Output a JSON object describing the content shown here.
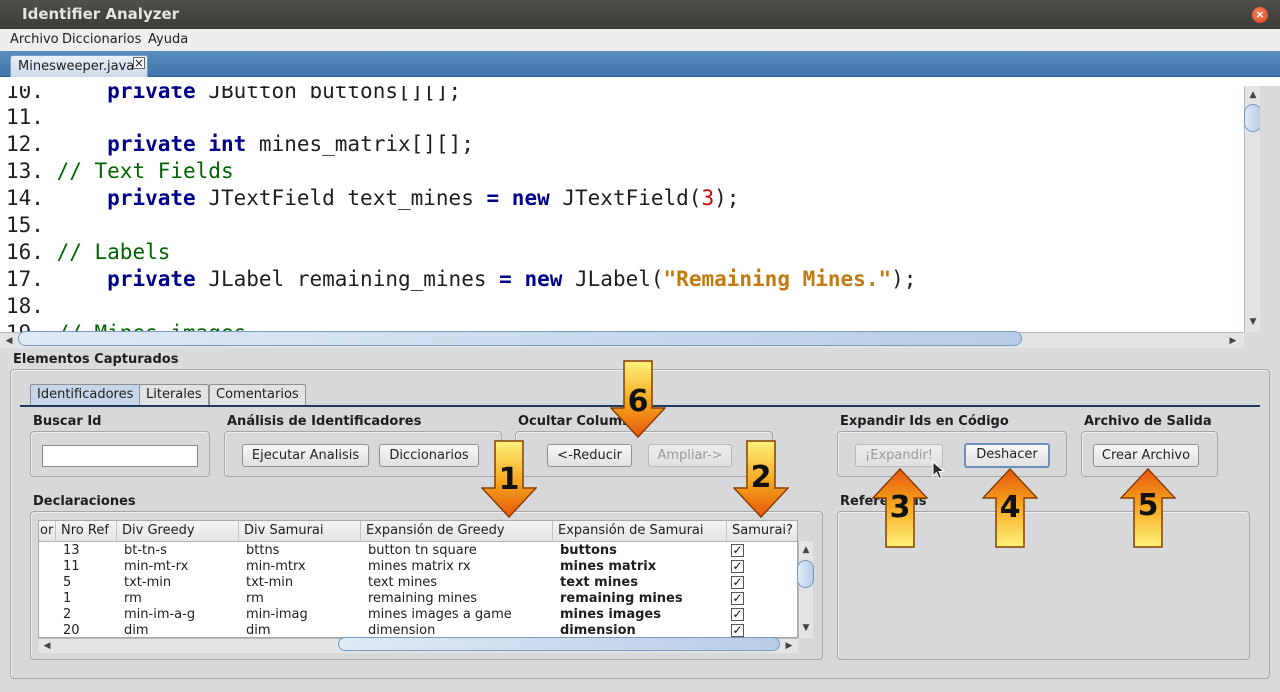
{
  "window": {
    "title": "Identifier Analyzer",
    "close_glyph": "×"
  },
  "menu": [
    "Archivo",
    "Diccionarios",
    "Ayuda"
  ],
  "editor_tab": {
    "label": "Minesweeper.java",
    "close_glyph": "×"
  },
  "code_lines": [
    {
      "num": "10.",
      "parts": [
        [
          "",
          "    "
        ],
        [
          "kw",
          "private"
        ],
        [
          "",
          " JButton buttons[][];"
        ]
      ]
    },
    {
      "num": "11.",
      "parts": []
    },
    {
      "num": "12.",
      "parts": [
        [
          "",
          "    "
        ],
        [
          "kw",
          "private"
        ],
        [
          "",
          " "
        ],
        [
          "kw",
          "int"
        ],
        [
          "",
          " mines_matrix[][];"
        ]
      ]
    },
    {
      "num": "13.",
      "parts": [
        [
          "cm",
          "// Text Fields"
        ]
      ]
    },
    {
      "num": "14.",
      "parts": [
        [
          "",
          "    "
        ],
        [
          "kw",
          "private"
        ],
        [
          "",
          " JTextField text_mines "
        ],
        [
          "kw",
          "="
        ],
        [
          "",
          " "
        ],
        [
          "kw",
          "new"
        ],
        [
          "",
          " JTextField("
        ],
        [
          "num",
          "3"
        ],
        [
          "",
          ");"
        ]
      ]
    },
    {
      "num": "15.",
      "parts": []
    },
    {
      "num": "16.",
      "parts": [
        [
          "cm",
          "// Labels"
        ]
      ]
    },
    {
      "num": "17.",
      "parts": [
        [
          "",
          "    "
        ],
        [
          "kw",
          "private"
        ],
        [
          "",
          " JLabel remaining_mines "
        ],
        [
          "kw",
          "="
        ],
        [
          "",
          " "
        ],
        [
          "kw",
          "new"
        ],
        [
          "",
          " JLabel("
        ],
        [
          "str",
          "\"Remaining Mines.\""
        ],
        [
          "",
          ");"
        ]
      ]
    },
    {
      "num": "18.",
      "parts": []
    },
    {
      "num": "19.",
      "parts": [
        [
          "cm",
          "// Mines images"
        ]
      ]
    }
  ],
  "panel": {
    "title": "Elementos Capturados",
    "tabs": [
      "Identificadores",
      "Literales",
      "Comentarios"
    ],
    "buscar": {
      "title": "Buscar Id",
      "value": ""
    },
    "analisis": {
      "title": "Análisis de Identificadores",
      "run": "Ejecutar Analisis",
      "dict": "Diccionarios"
    },
    "ocultar": {
      "title": "Ocultar Columnas",
      "reduce": "<-Reducir",
      "expand": "Ampliar->"
    },
    "expandir": {
      "title": "Expandir Ids en Código",
      "expand": "¡Expandir!",
      "undo": "Deshacer"
    },
    "salida": {
      "title": "Archivo de Salida",
      "create": "Crear Archivo"
    },
    "declaraciones": "Declaraciones",
    "referencias": "Referencias"
  },
  "table": {
    "columns": [
      "or",
      "Nro Ref",
      "Div Greedy",
      "Div Samurai",
      "Expansión de Greedy",
      "Expansión de Samurai",
      "Samurai?"
    ],
    "rows": [
      [
        "13",
        "bt-tn-s",
        "bttns",
        "button tn square",
        "buttons"
      ],
      [
        "11",
        "min-mt-rx",
        "min-mtrx",
        "mines matrix rx",
        "mines matrix"
      ],
      [
        "5",
        "txt-min",
        "txt-min",
        "text mines",
        "text mines"
      ],
      [
        "1",
        "rm",
        "rm",
        "remaining mines",
        "remaining mines"
      ],
      [
        "2",
        "min-im-a-g",
        "min-imag",
        "mines images a game",
        "mines images"
      ],
      [
        "20",
        "dim",
        "dim",
        "dimension",
        "dimension"
      ]
    ],
    "check_glyph": "✓"
  },
  "callouts": [
    "1",
    "2",
    "3",
    "4",
    "5",
    "6"
  ],
  "scroll_glyphs": {
    "up": "▲",
    "down": "▼",
    "left": "◀",
    "right": "▶"
  }
}
